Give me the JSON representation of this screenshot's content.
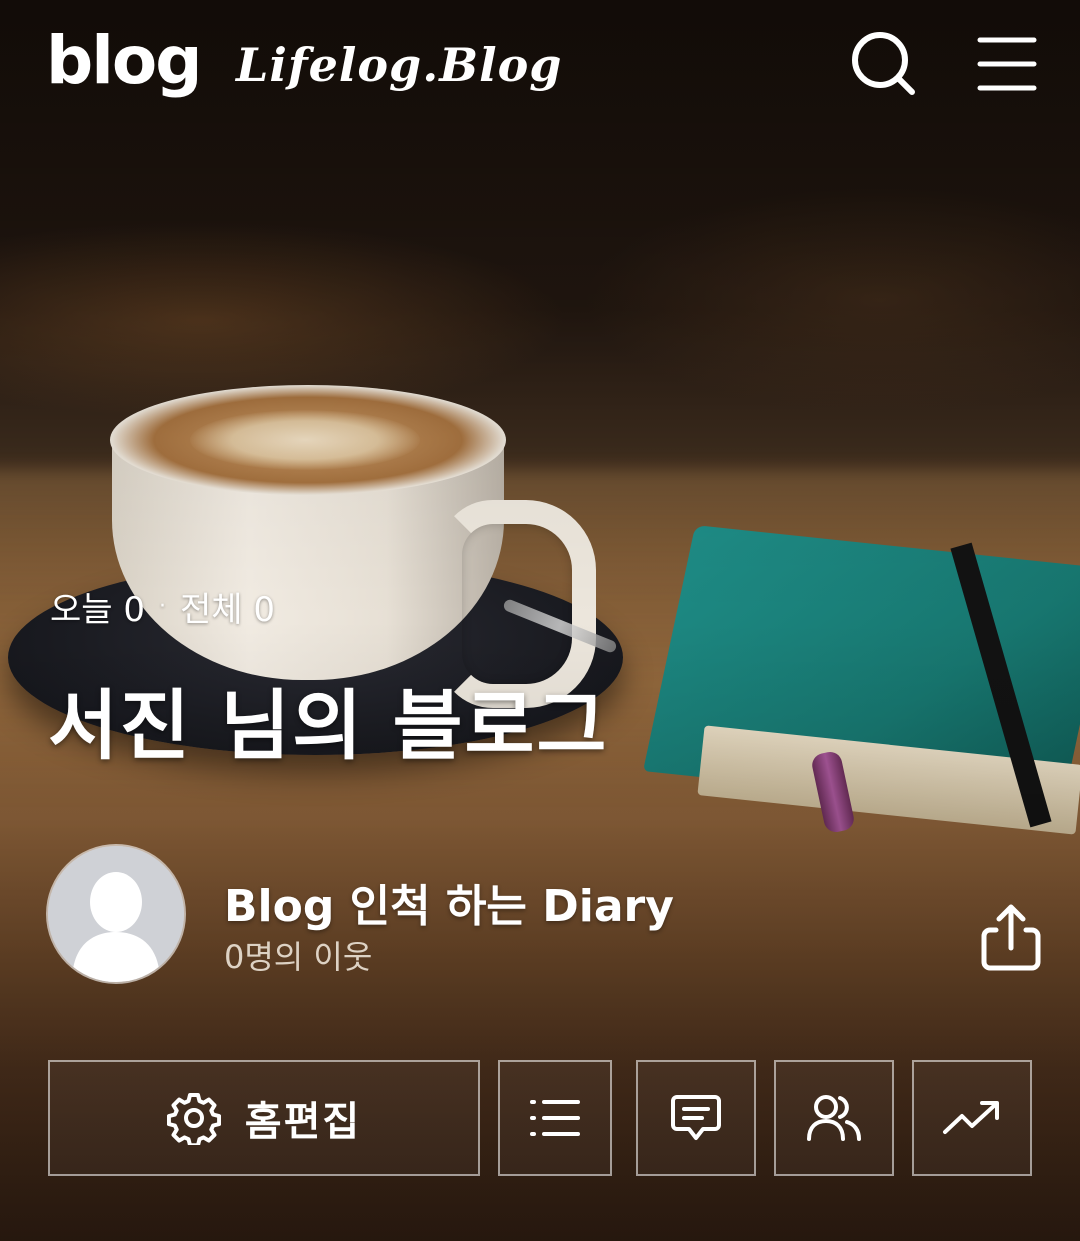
{
  "header": {
    "logo": "blog",
    "blog_name": "Lifelog.Blog",
    "search_icon": "search-icon",
    "menu_icon": "hamburger-menu-icon"
  },
  "stats": {
    "today_label": "오늘 0",
    "separator": "·",
    "total_label": "전체 0"
  },
  "title": "서진 님의 블로그",
  "profile": {
    "name": "Blog 인척 하는 Diary",
    "neighbors": "0명의 이웃",
    "avatar_icon": "default-avatar-icon",
    "share_icon": "share-icon"
  },
  "actions": {
    "edit_label": "홈편집",
    "edit_icon": "gear-icon",
    "list_icon": "list-icon",
    "comments_icon": "comment-icon",
    "neighbors_icon": "people-icon",
    "stats_icon": "trending-up-icon"
  }
}
